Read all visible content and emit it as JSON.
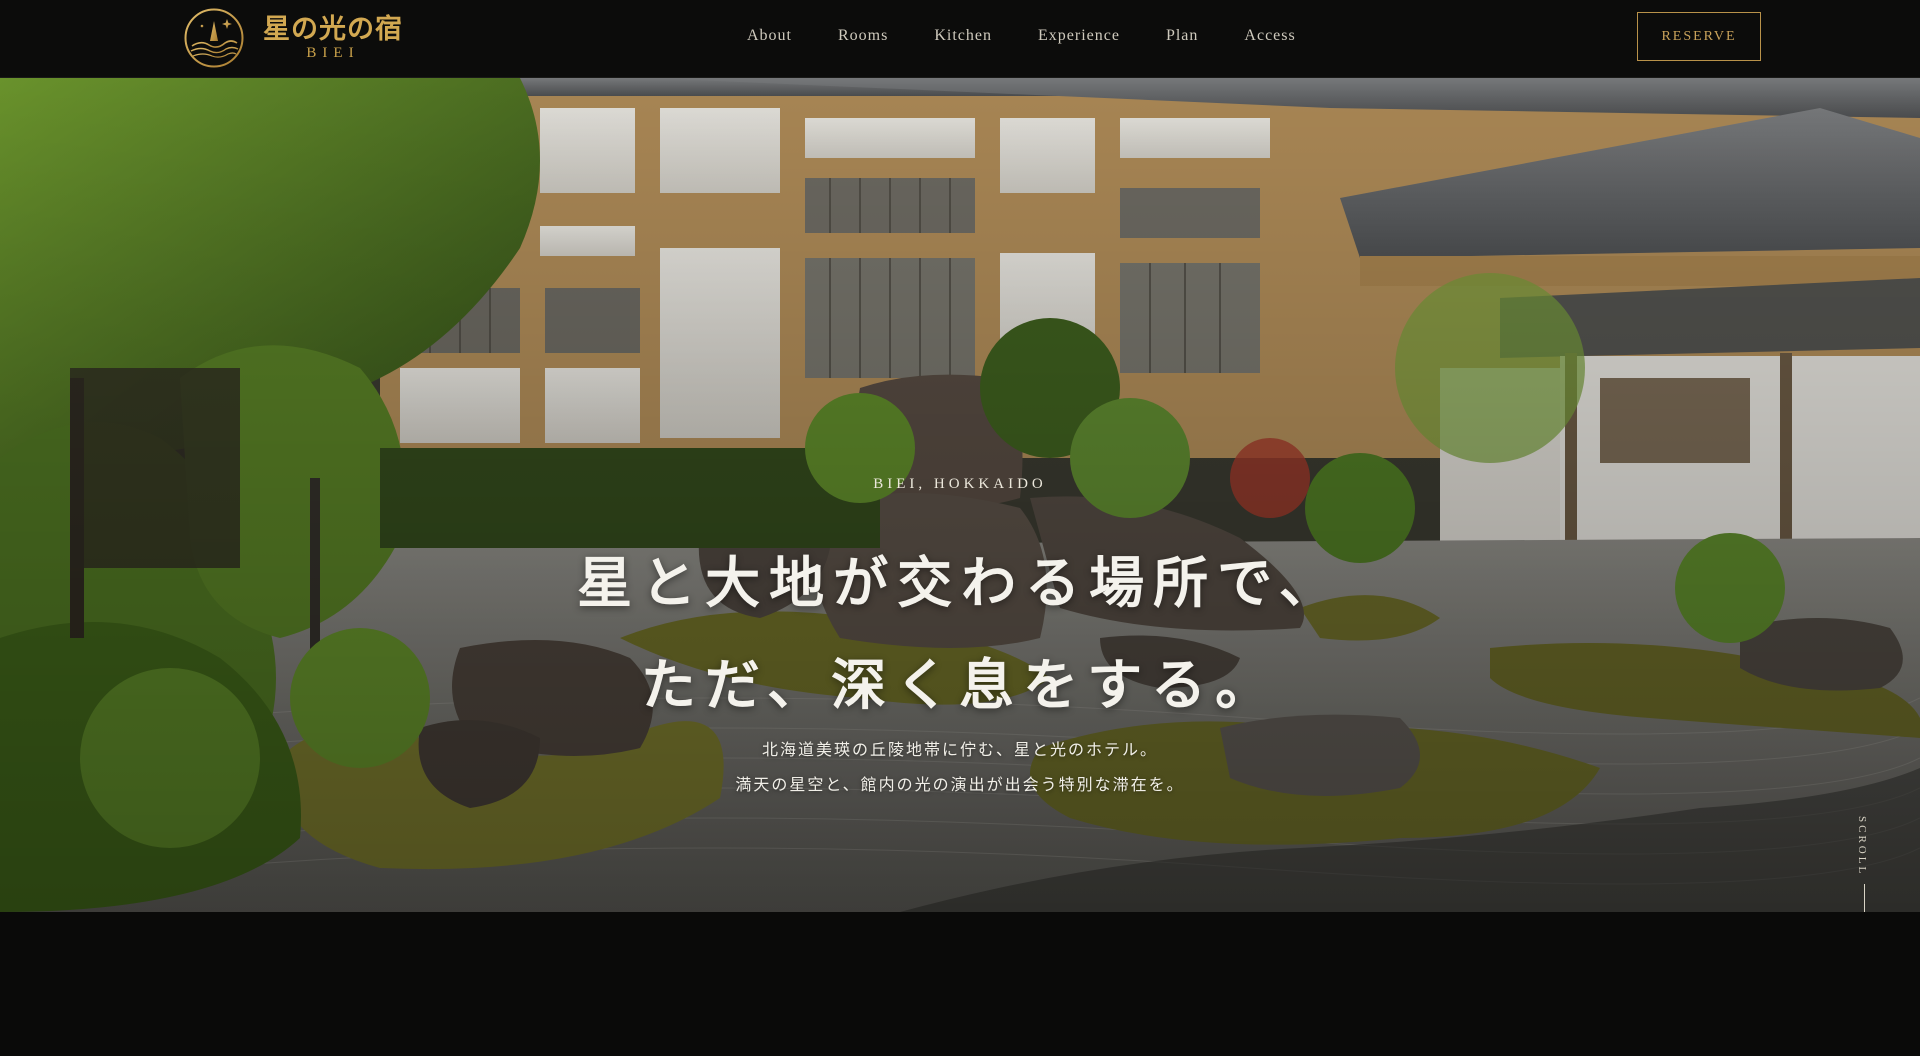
{
  "brand": {
    "name_jp": "星の光の宿",
    "name_en": "BIEI",
    "logo_icon": "mountain-star-emblem-icon",
    "accent_color": "#c9a14a"
  },
  "nav": {
    "items": [
      "About",
      "Rooms",
      "Kitchen",
      "Experience",
      "Plan",
      "Access"
    ],
    "reserve_label": "RESERVE"
  },
  "hero": {
    "eyebrow": "BIEI, HOKKAIDO",
    "title_line1": "星と大地が交わる場所で、",
    "title_line2": "ただ、深く息をする。",
    "subtitle_line1": "北海道美瑛の丘陵地帯に佇む、星と光のホテル。",
    "subtitle_line2": "満天の星空と、館内の光の演出が出会う特別な滞在を。",
    "image": "japanese-zen-garden-photo"
  },
  "scroll": {
    "label": "SCROLL",
    "icon": "scroll-line-indicator"
  }
}
